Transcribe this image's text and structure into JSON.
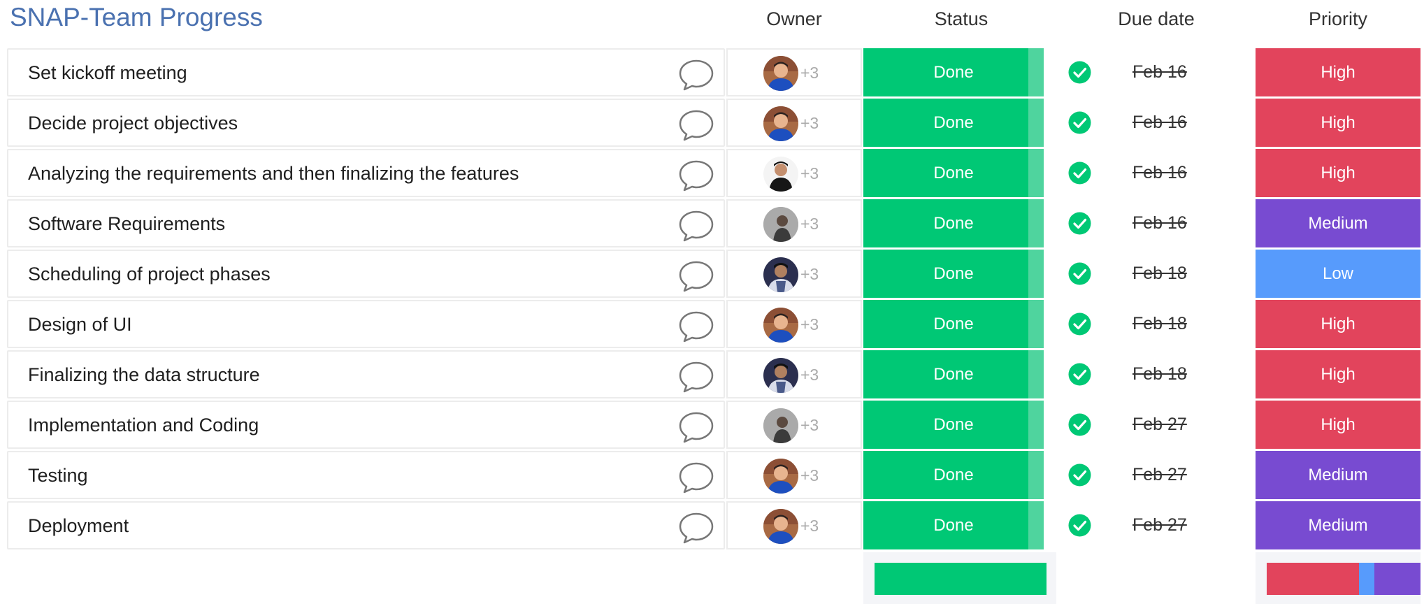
{
  "board": {
    "title": "SNAP-Team Progress",
    "columns": {
      "owner": "Owner",
      "status": "Status",
      "due_date": "Due date",
      "priority": "Priority"
    }
  },
  "colors": {
    "done": "#00c875",
    "done_edge": "#4fd49e",
    "high": "#e2445c",
    "medium": "#784bd1",
    "low": "#579bfc",
    "check": "#00c875"
  },
  "tasks": [
    {
      "name": "Set kickoff meeting",
      "owner_extra": "+3",
      "avatar": "avatar-a",
      "status": "Done",
      "due": "Feb 16",
      "priority": "High",
      "priority_level": "high"
    },
    {
      "name": "Decide project objectives",
      "owner_extra": "+3",
      "avatar": "avatar-a",
      "status": "Done",
      "due": "Feb 16",
      "priority": "High",
      "priority_level": "high"
    },
    {
      "name": "Analyzing the requirements and then finalizing the features",
      "owner_extra": "+3",
      "avatar": "avatar-b",
      "status": "Done",
      "due": "Feb 16",
      "priority": "High",
      "priority_level": "high"
    },
    {
      "name": "Software Requirements",
      "owner_extra": "+3",
      "avatar": "avatar-c",
      "status": "Done",
      "due": "Feb 16",
      "priority": "Medium",
      "priority_level": "medium"
    },
    {
      "name": "Scheduling of project phases",
      "owner_extra": "+3",
      "avatar": "avatar-d",
      "status": "Done",
      "due": "Feb 18",
      "priority": "Low",
      "priority_level": "low"
    },
    {
      "name": "Design of UI",
      "owner_extra": "+3",
      "avatar": "avatar-a",
      "status": "Done",
      "due": "Feb 18",
      "priority": "High",
      "priority_level": "high"
    },
    {
      "name": "Finalizing the data structure",
      "owner_extra": "+3",
      "avatar": "avatar-d",
      "status": "Done",
      "due": "Feb 18",
      "priority": "High",
      "priority_level": "high"
    },
    {
      "name": "Implementation and Coding",
      "owner_extra": "+3",
      "avatar": "avatar-c",
      "status": "Done",
      "due": "Feb 27",
      "priority": "High",
      "priority_level": "high"
    },
    {
      "name": "Testing",
      "owner_extra": "+3",
      "avatar": "avatar-a",
      "status": "Done",
      "due": "Feb 27",
      "priority": "Medium",
      "priority_level": "medium"
    },
    {
      "name": "Deployment",
      "owner_extra": "+3",
      "avatar": "avatar-a",
      "status": "Done",
      "due": "Feb 27",
      "priority": "Medium",
      "priority_level": "medium"
    }
  ],
  "summary": {
    "status": [
      {
        "level": "done",
        "fraction": 1.0
      }
    ],
    "priority": [
      {
        "level": "high",
        "fraction": 0.6
      },
      {
        "level": "low",
        "fraction": 0.1
      },
      {
        "level": "medium",
        "fraction": 0.3
      }
    ]
  }
}
